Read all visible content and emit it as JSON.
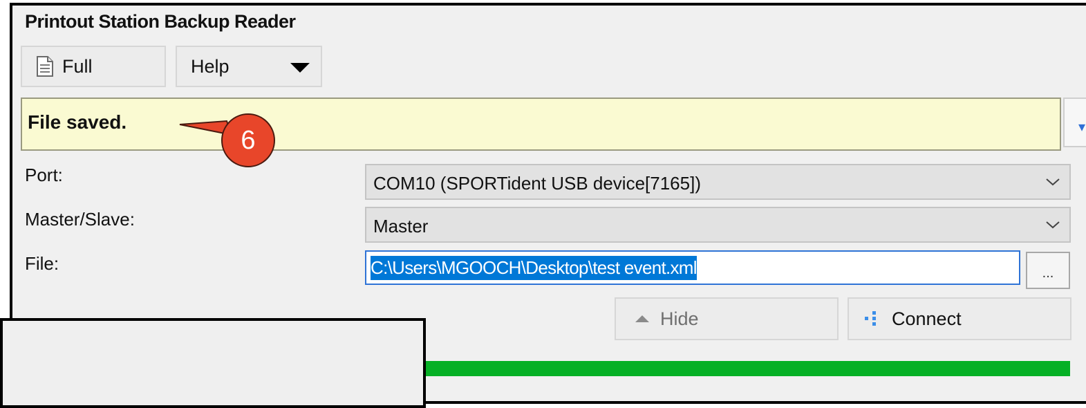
{
  "window": {
    "title": "Printout Station Backup Reader"
  },
  "toolbar": {
    "full_label": "Full",
    "help_label": "Help"
  },
  "status": {
    "message": "File saved."
  },
  "form": {
    "port_label": "Port:",
    "port_value": "COM10 (SPORTident USB device[7165])",
    "master_slave_label": "Master/Slave:",
    "master_slave_value": "Master",
    "file_label": "File:",
    "file_value": "C:\\Users\\MGOOCH\\Desktop\\test event.xml",
    "browse_label": "..."
  },
  "actions": {
    "hide_label": "Hide",
    "connect_label": "Connect"
  },
  "progress": {
    "value_percent": 100,
    "color": "#06b025"
  },
  "callout": {
    "number": "6",
    "color": "#e8462a"
  },
  "icons": {
    "full": "document-icon",
    "help": "dropdown-arrow-icon",
    "hide": "triangle-up-icon",
    "connect": "connect-icon",
    "combo": "chevron-down-icon"
  }
}
